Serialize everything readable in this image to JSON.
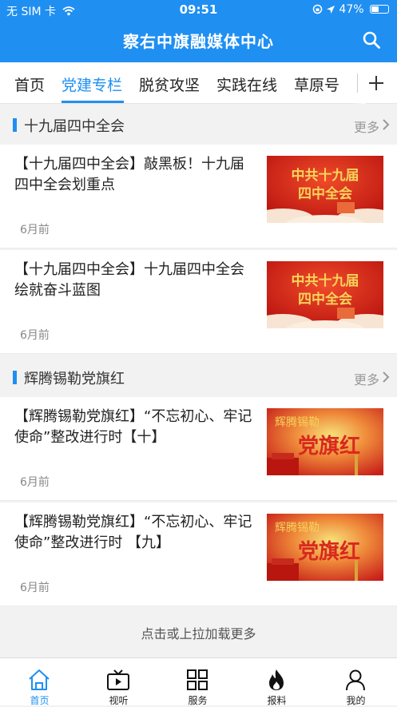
{
  "status_bar": {
    "carrier": "无 SIM 卡",
    "time": "09:51",
    "battery": "47%"
  },
  "header": {
    "title": "察右中旗融媒体中心",
    "search_icon": "search-icon"
  },
  "tabs": [
    {
      "label": "首页",
      "active": false
    },
    {
      "label": "党建专栏",
      "active": true
    },
    {
      "label": "脱贫攻坚",
      "active": false
    },
    {
      "label": "实践在线",
      "active": false
    },
    {
      "label": "草原号",
      "active": false
    }
  ],
  "sections": [
    {
      "title": "十九届四中全会",
      "more": "更多",
      "articles": [
        {
          "title": "【十九届四中全会】敲黑板！十九届四中全会划重点",
          "time": "6月前",
          "thumb_text": [
            "中共十九届",
            "四中全会"
          ]
        },
        {
          "title": "【十九届四中全会】十九届四中全会绘就奋斗蓝图",
          "time": "6月前",
          "thumb_text": [
            "中共十九届",
            "四中全会"
          ]
        }
      ]
    },
    {
      "title": "辉腾锡勒党旗红",
      "more": "更多",
      "articles": [
        {
          "title": "【辉腾锡勒党旗红】“不忘初心、牢记使命”整改进行时【十】",
          "time": "6月前",
          "thumb_text": [
            "辉腾锡勒",
            "党旗红"
          ]
        },
        {
          "title": "【辉腾锡勒党旗红】“不忘初心、牢记使命”整改进行时 【九】",
          "time": "6月前",
          "thumb_text": [
            "辉腾锡勒",
            "党旗红"
          ]
        }
      ]
    }
  ],
  "load_more": "点击或上拉加载更多",
  "tabbar": [
    {
      "label": "首页",
      "icon": "home-icon",
      "active": true
    },
    {
      "label": "视听",
      "icon": "video-icon",
      "active": false
    },
    {
      "label": "服务",
      "icon": "grid-icon",
      "active": false
    },
    {
      "label": "报料",
      "icon": "flame-icon",
      "active": false
    },
    {
      "label": "我的",
      "icon": "user-icon",
      "active": false
    }
  ],
  "colors": {
    "brand": "#1f8ff2",
    "thumb_red": "#d8281e",
    "thumb_gold": "#f5d35c"
  }
}
